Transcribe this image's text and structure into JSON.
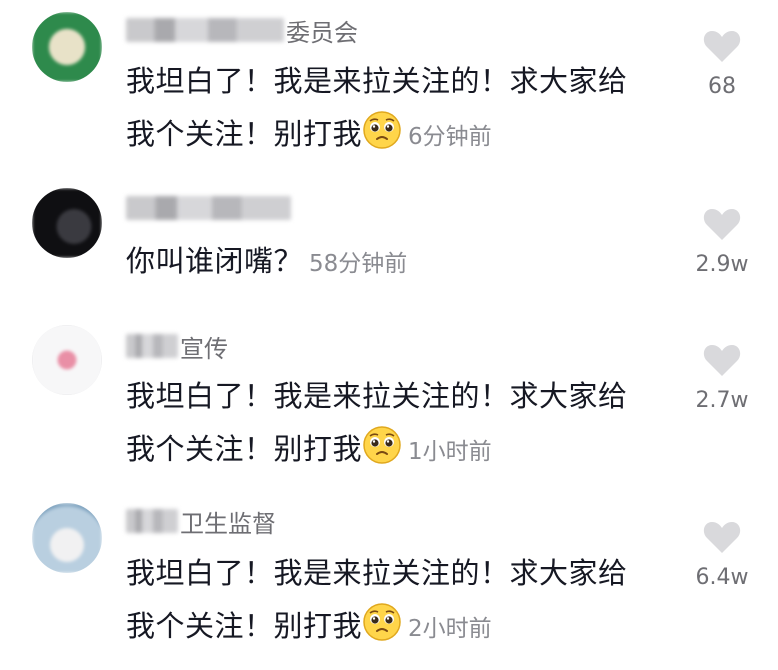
{
  "comments": [
    {
      "username_suffix": "委员会",
      "text_line1": "我坦白了！我是来拉关注的！求大家给",
      "text_line2": "我个关注！别打我",
      "time": "6分钟前",
      "likes": "68"
    },
    {
      "username_suffix": "",
      "text_line1": "你叫谁闭嘴？",
      "text_line2": "",
      "time": "58分钟前",
      "likes": "2.9w"
    },
    {
      "username_suffix": "宣传",
      "text_line1": "我坦白了！我是来拉关注的！求大家给",
      "text_line2": "我个关注！别打我",
      "time": "1小时前",
      "likes": "2.7w"
    },
    {
      "username_suffix": "卫生监督",
      "text_line1": "我坦白了！我是来拉关注的！求大家给",
      "text_line2": "我个关注！别打我",
      "time": "2小时前",
      "likes": "6.4w"
    }
  ],
  "icons": {
    "like": "heart-icon",
    "emoji": "pleading-face-emoji"
  },
  "colors": {
    "text": "#161823",
    "secondary": "#8a8b91",
    "heart": "#d9d9dc"
  }
}
